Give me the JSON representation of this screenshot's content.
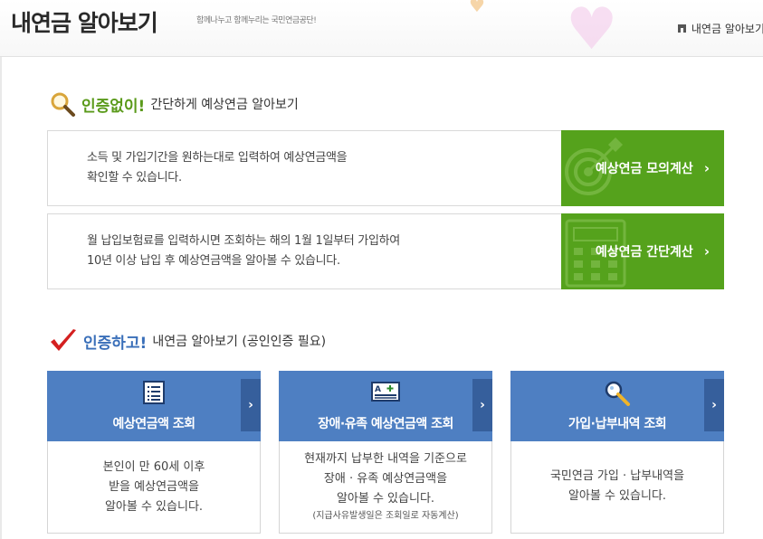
{
  "header": {
    "title": "내연금 알아보기",
    "tagline": "함께나누고 함께누리는 국민연금공단!",
    "breadcrumb": "내연금 알아보기"
  },
  "section_no_cert": {
    "emph": "인증없이!",
    "desc": "간단하게 예상연금 알아보기",
    "rows": [
      {
        "line1": "소득 및 가입기간을 원하는대로 입력하여 예상연금액을",
        "line2": "확인할 수 있습니다.",
        "button": "예상연금 모의계산"
      },
      {
        "line1": "월 납입보험료를 입력하시면 조회하는 해의 1월 1일부터 가입하여",
        "line2": "10년 이상 납입 후 예상연금액을 알아볼 수 있습니다.",
        "button": "예상연금 간단계산"
      }
    ]
  },
  "section_cert": {
    "emph": "인증하고!",
    "desc": "내연금 알아보기 (공인인증 필요)",
    "cards": [
      {
        "title": "예상연금액 조회",
        "icon": "document-list-icon",
        "lines": [
          "본인이 만 60세 이후",
          "받을 예상연금액을",
          "알아볼 수 있습니다."
        ]
      },
      {
        "title": "장애·유족 예상연금액 조회",
        "icon": "id-card-plus-icon",
        "lines": [
          "현재까지 납부한 내역을 기준으로",
          "장애 · 유족 예상연금액을",
          "알아볼 수 있습니다."
        ],
        "note": "(지급사유발생일은 조회일로 자동계산)"
      },
      {
        "title": "가입·납부내역 조회",
        "icon": "magnifier-icon",
        "lines": [
          "국민연금 가입 · 납부내역을",
          "알아볼 수 있습니다."
        ]
      }
    ]
  },
  "arrow_glyph": "›",
  "colors": {
    "green": "#55a21c",
    "blue": "#4e7fc2",
    "blue_dark": "#365f9c",
    "heading_green": "#5a9a1a",
    "heading_blue": "#3a6fb9",
    "check_red": "#d42020"
  }
}
